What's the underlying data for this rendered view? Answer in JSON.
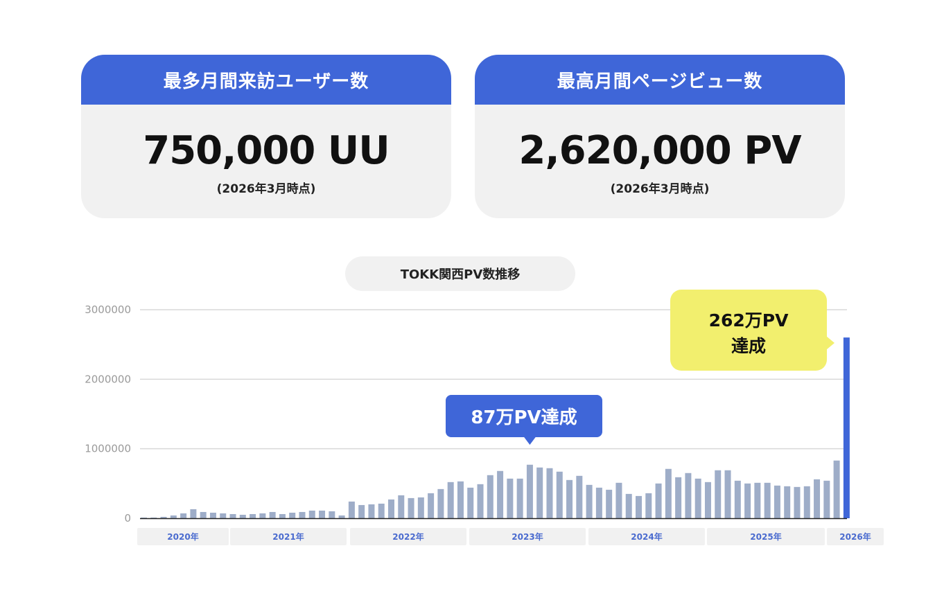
{
  "cards": [
    {
      "title": "最多月間来訪ユーザー数",
      "value": "750,000 UU",
      "note": "(2026年3月時点)"
    },
    {
      "title": "最高月間ページビュー数",
      "value": "2,620,000 PV",
      "note": "(2026年3月時点)"
    }
  ],
  "colors": {
    "accent": "#3f66d8",
    "bar": "#9eadc8",
    "bar_highlight": "#3f66d8",
    "callout_yellow": "#f2ef6e",
    "panel": "#f1f1f1"
  },
  "chart_data": {
    "type": "bar",
    "title": "TOKK関西PV数推移",
    "y_ticks": [
      "0",
      "1000000",
      "2000000",
      "3000000"
    ],
    "ylim": [
      0,
      3000000
    ],
    "grid": true,
    "year_labels": [
      "2020年",
      "2021年",
      "2022年",
      "2023年",
      "2024年",
      "2025年",
      "2026年"
    ],
    "values": [
      10000,
      10000,
      20000,
      40000,
      70000,
      130000,
      90000,
      80000,
      70000,
      60000,
      50000,
      60000,
      70000,
      90000,
      60000,
      80000,
      90000,
      110000,
      110000,
      100000,
      40000,
      240000,
      190000,
      200000,
      210000,
      270000,
      330000,
      290000,
      300000,
      360000,
      420000,
      520000,
      530000,
      440000,
      490000,
      620000,
      680000,
      570000,
      570000,
      770000,
      730000,
      720000,
      670000,
      550000,
      610000,
      480000,
      440000,
      410000,
      510000,
      350000,
      320000,
      360000,
      500000,
      710000,
      590000,
      650000,
      570000,
      520000,
      690000,
      690000,
      540000,
      500000,
      510000,
      510000,
      470000,
      460000,
      450000,
      460000,
      560000,
      540000,
      830000,
      2600000
    ],
    "highlight_index": 71,
    "annotations": [
      {
        "text": "87万PV達成",
        "index": 39
      },
      {
        "text_line1": "262万PV",
        "text_line2": "達成",
        "index": 71
      }
    ]
  }
}
